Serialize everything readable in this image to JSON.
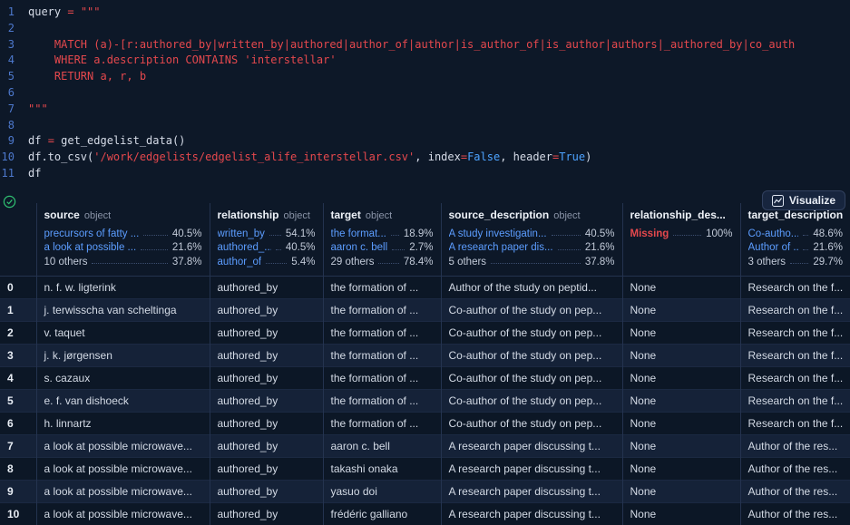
{
  "editor": {
    "lines": [
      {
        "no": "1",
        "segs": [
          {
            "t": "query ",
            "c": "p"
          },
          {
            "t": "= ",
            "c": "o"
          },
          {
            "t": "\"\"\"",
            "c": "s"
          }
        ]
      },
      {
        "no": "2",
        "segs": []
      },
      {
        "no": "3",
        "segs": [
          {
            "t": "    MATCH (a)-[r:authored_by|written_by|authored|author_of|author|is_author_of|is_author|authors|_authored_by|co_auth",
            "c": "s"
          }
        ]
      },
      {
        "no": "4",
        "segs": [
          {
            "t": "    WHERE a.description CONTAINS 'interstellar'",
            "c": "s"
          }
        ]
      },
      {
        "no": "5",
        "segs": [
          {
            "t": "    RETURN a, r, b",
            "c": "s"
          }
        ]
      },
      {
        "no": "6",
        "segs": []
      },
      {
        "no": "7",
        "segs": [
          {
            "t": "\"\"\"",
            "c": "s"
          }
        ]
      },
      {
        "no": "8",
        "segs": []
      },
      {
        "no": "9",
        "segs": [
          {
            "t": "df ",
            "c": "p"
          },
          {
            "t": "= ",
            "c": "o"
          },
          {
            "t": "get_edgelist_data()",
            "c": "p"
          }
        ]
      },
      {
        "no": "10",
        "segs": [
          {
            "t": "df.to_csv(",
            "c": "p"
          },
          {
            "t": "'/work/edgelists/edgelist_alife_interstellar.csv'",
            "c": "s"
          },
          {
            "t": ", index",
            "c": "p"
          },
          {
            "t": "=",
            "c": "o"
          },
          {
            "t": "False",
            "c": "k"
          },
          {
            "t": ", header",
            "c": "p"
          },
          {
            "t": "=",
            "c": "o"
          },
          {
            "t": "True",
            "c": "k"
          },
          {
            "t": ")",
            "c": "p"
          }
        ]
      },
      {
        "no": "11",
        "segs": [
          {
            "t": "df",
            "c": "p"
          }
        ]
      }
    ]
  },
  "output": {
    "visualize_label": "Visualize",
    "table": {
      "columns": [
        {
          "name": "source",
          "type": "object"
        },
        {
          "name": "relationship",
          "type": "object"
        },
        {
          "name": "target",
          "type": "object"
        },
        {
          "name": "source_description",
          "type": "object"
        },
        {
          "name": "relationship_des...",
          "type": ""
        },
        {
          "name": "target_description",
          "type": ""
        }
      ],
      "stats": {
        "source": [
          {
            "label": "precursors of fatty ...",
            "pct": "40.5%"
          },
          {
            "label": "a look at possible ...",
            "pct": "21.6%"
          },
          {
            "label": "10 others",
            "pct": "37.8%"
          }
        ],
        "relationship": [
          {
            "label": "written_by",
            "pct": "54.1%"
          },
          {
            "label": "authored_...",
            "pct": "40.5%"
          },
          {
            "label": "author_of",
            "pct": "5.4%"
          }
        ],
        "target": [
          {
            "label": "the format...",
            "pct": "18.9%"
          },
          {
            "label": "aaron c. bell",
            "pct": "2.7%"
          },
          {
            "label": "29 others",
            "pct": "78.4%"
          }
        ],
        "source_description": [
          {
            "label": "A study investigatin...",
            "pct": "40.5%"
          },
          {
            "label": "A research paper dis...",
            "pct": "21.6%"
          },
          {
            "label": "5 others",
            "pct": "37.8%"
          }
        ],
        "relationship_description": [
          {
            "label": "Missing",
            "pct": "100%"
          }
        ],
        "target_description": [
          {
            "label": "Co-autho...",
            "pct": "48.6%"
          },
          {
            "label": "Author of ...",
            "pct": "21.6%"
          },
          {
            "label": "3 others",
            "pct": "29.7%"
          }
        ]
      },
      "rows": [
        [
          "0",
          "n. f. w. ligterink",
          "authored_by",
          "the formation of ...",
          "Author of the study on peptid...",
          "None",
          "Research on the f..."
        ],
        [
          "1",
          "j. terwisscha van scheltinga",
          "authored_by",
          "the formation of ...",
          "Co-author of the study on pep...",
          "None",
          "Research on the f..."
        ],
        [
          "2",
          "v. taquet",
          "authored_by",
          "the formation of ...",
          "Co-author of the study on pep...",
          "None",
          "Research on the f..."
        ],
        [
          "3",
          "j. k. jørgensen",
          "authored_by",
          "the formation of ...",
          "Co-author of the study on pep...",
          "None",
          "Research on the f..."
        ],
        [
          "4",
          "s. cazaux",
          "authored_by",
          "the formation of ...",
          "Co-author of the study on pep...",
          "None",
          "Research on the f..."
        ],
        [
          "5",
          "e. f. van dishoeck",
          "authored_by",
          "the formation of ...",
          "Co-author of the study on pep...",
          "None",
          "Research on the f..."
        ],
        [
          "6",
          "h. linnartz",
          "authored_by",
          "the formation of ...",
          "Co-author of the study on pep...",
          "None",
          "Research on the f..."
        ],
        [
          "7",
          "a look at possible microwave...",
          "authored_by",
          "aaron c. bell",
          "A research paper discussing t...",
          "None",
          "Author of the res..."
        ],
        [
          "8",
          "a look at possible microwave...",
          "authored_by",
          "takashi onaka",
          "A research paper discussing t...",
          "None",
          "Author of the res..."
        ],
        [
          "9",
          "a look at possible microwave...",
          "authored_by",
          "yasuo doi",
          "A research paper discussing t...",
          "None",
          "Author of the res..."
        ],
        [
          "10",
          "a look at possible microwave...",
          "authored_by",
          "frédéric galliano",
          "A research paper discussing t...",
          "None",
          "Author of the res..."
        ]
      ]
    }
  }
}
